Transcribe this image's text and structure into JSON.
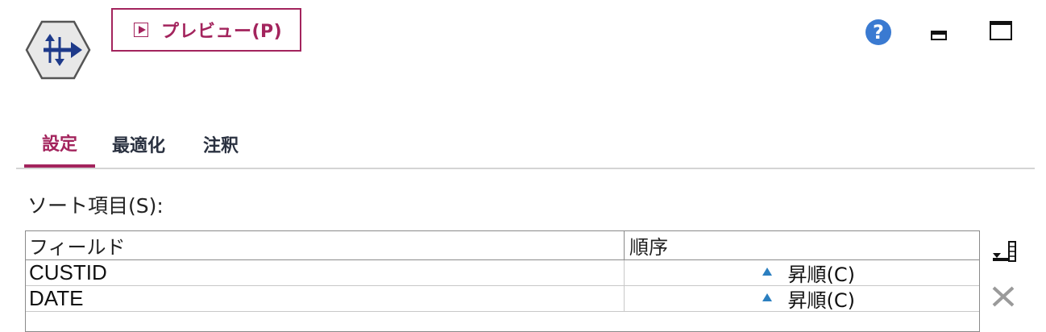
{
  "toolbar": {
    "preview_label": "プレビュー(P)",
    "help_symbol": "?"
  },
  "tabs": [
    {
      "label": "設定",
      "active": true
    },
    {
      "label": "最適化",
      "active": false
    },
    {
      "label": "注釈",
      "active": false
    }
  ],
  "sort": {
    "label": "ソート項目(S):",
    "columns": [
      "フィールド",
      "順序"
    ],
    "rows": [
      {
        "field": "CUSTID",
        "order": "昇順(C)",
        "order_icon": "ascending-icon"
      },
      {
        "field": "DATE",
        "order": "昇順(C)",
        "order_icon": "ascending-icon"
      }
    ]
  },
  "icons": {
    "node": "sort-node-icon",
    "help": "help-icon",
    "minimize": "minimize-icon",
    "maximize": "maximize-icon",
    "add": "add-field-icon",
    "delete": "delete-icon"
  },
  "colors": {
    "accent": "#a3245d",
    "help_blue": "#3a7ad1",
    "node_blue": "#1e3a8a",
    "ascending_blue": "#2b7fc0"
  }
}
